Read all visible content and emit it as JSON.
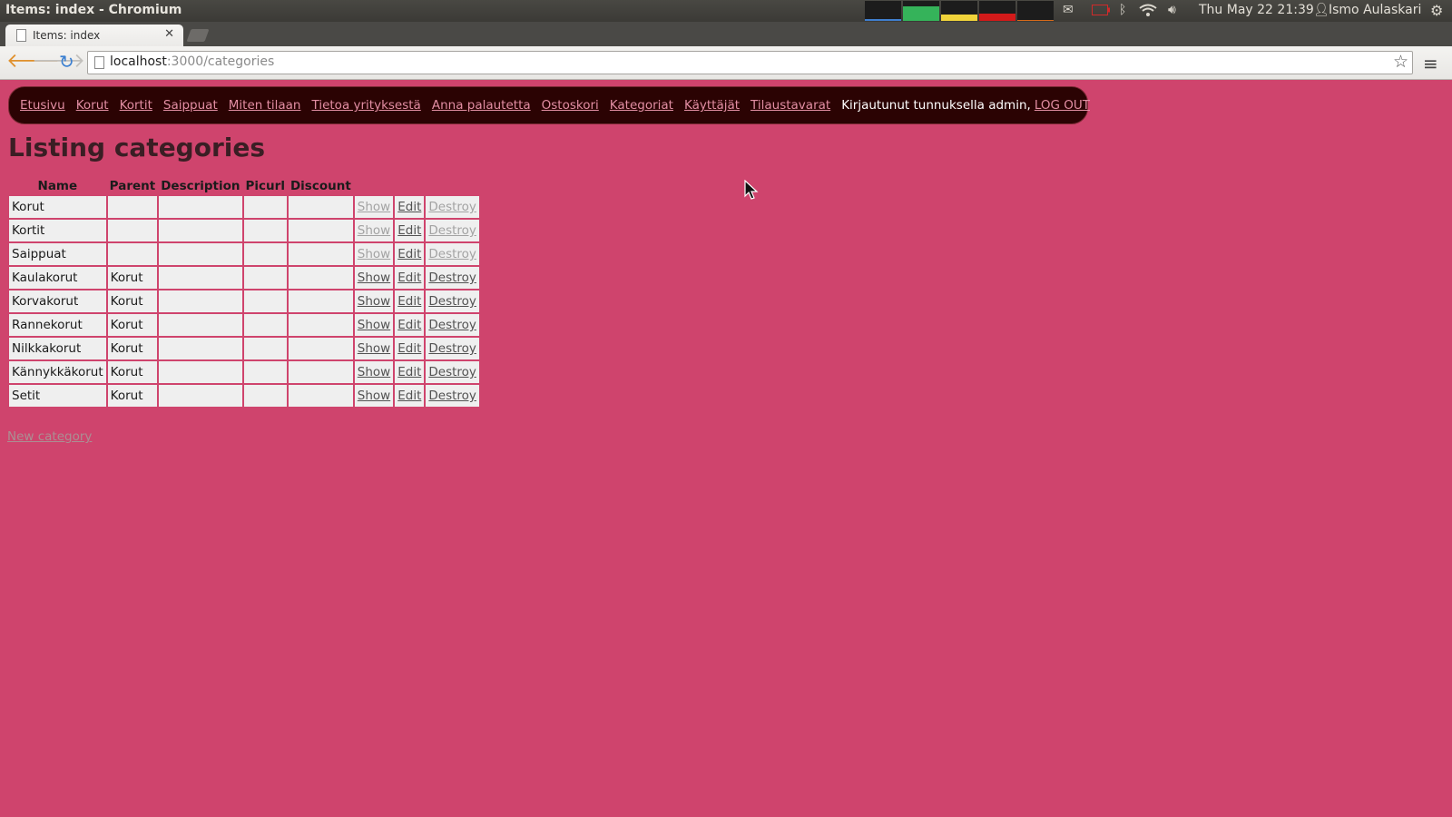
{
  "os_panel": {
    "window_title": "Items: index - Chromium",
    "clock": "Thu May 22 21:39",
    "user": "Ismo Aulaskari",
    "indicator_levels": [
      0.1,
      0.75,
      0.3,
      0.35,
      0.05
    ],
    "indicator_colors": [
      "#3f7fcf",
      "#35b35a",
      "#f0d33a",
      "#d21a1a",
      "#d66a1a"
    ]
  },
  "browser": {
    "tab_title": "Items: index",
    "url_host": "localhost",
    "url_rest": ":3000/categories"
  },
  "site_nav": {
    "links": [
      "Etusivu",
      "Korut",
      "Kortit",
      "Saippuat",
      "Miten tilaan",
      "Tietoa yrityksestä",
      "Anna palautetta",
      "Ostoskori",
      "Kategoriat",
      "Käyttäjät",
      "Tilaustavarat"
    ],
    "login_text": "Kirjautunut tunnuksella admin,",
    "logout_label": "LOG OUT"
  },
  "page": {
    "title": "Listing categories",
    "columns": [
      "Name",
      "Parent",
      "Description",
      "Picurl",
      "Discount"
    ],
    "actions": {
      "show": "Show",
      "edit": "Edit",
      "destroy": "Destroy"
    },
    "rows": [
      {
        "name": "Korut",
        "parent": "",
        "description": "",
        "picurl": "",
        "discount": "",
        "show_dim": true,
        "destroy_dim": true
      },
      {
        "name": "Kortit",
        "parent": "",
        "description": "",
        "picurl": "",
        "discount": "",
        "show_dim": true,
        "destroy_dim": true
      },
      {
        "name": "Saippuat",
        "parent": "",
        "description": "",
        "picurl": "",
        "discount": "",
        "show_dim": true,
        "destroy_dim": true
      },
      {
        "name": "Kaulakorut",
        "parent": "Korut",
        "description": "",
        "picurl": "",
        "discount": "",
        "show_dim": false,
        "destroy_dim": false
      },
      {
        "name": "Korvakorut",
        "parent": "Korut",
        "description": "",
        "picurl": "",
        "discount": "",
        "show_dim": false,
        "destroy_dim": false
      },
      {
        "name": "Rannekorut",
        "parent": "Korut",
        "description": "",
        "picurl": "",
        "discount": "",
        "show_dim": false,
        "destroy_dim": false
      },
      {
        "name": "Nilkkakorut",
        "parent": "Korut",
        "description": "",
        "picurl": "",
        "discount": "",
        "show_dim": false,
        "destroy_dim": false
      },
      {
        "name": "Kännykkäkorut",
        "parent": "Korut",
        "description": "",
        "picurl": "",
        "discount": "",
        "show_dim": false,
        "destroy_dim": false
      },
      {
        "name": "Setit",
        "parent": "Korut",
        "description": "",
        "picurl": "",
        "discount": "",
        "show_dim": false,
        "destroy_dim": false
      }
    ],
    "new_link": "New category"
  },
  "colors": {
    "page_background": "#cf446d",
    "nav_background": "#2b0303",
    "nav_link": "#e28ea3",
    "cell_background": "#efefef"
  }
}
